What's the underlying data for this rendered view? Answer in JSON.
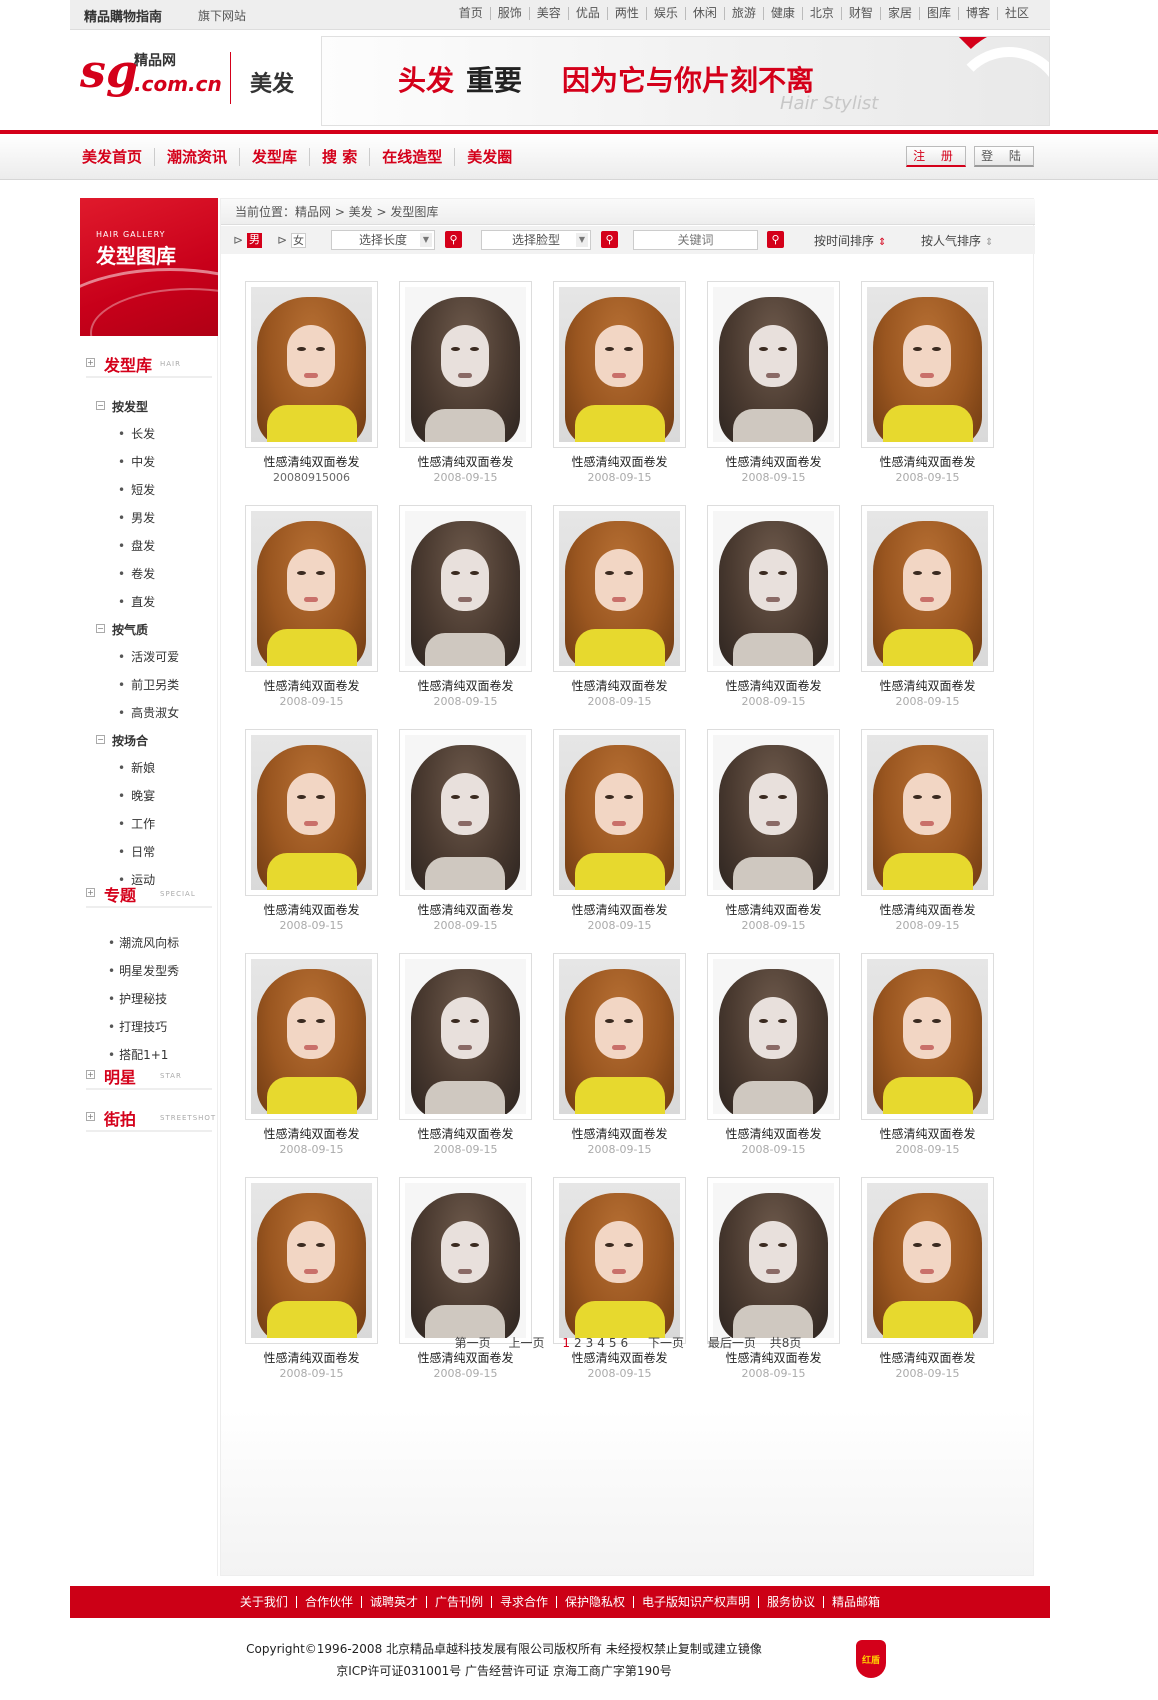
{
  "topbar": {
    "brand": "精品購物指南",
    "sub": "旗下网站",
    "links": [
      "首页",
      "服饰",
      "美容",
      "优品",
      "两性",
      "娱乐",
      "休闲",
      "旅游",
      "健康",
      "北京",
      "财智",
      "家居",
      "图库",
      "博客",
      "社区"
    ]
  },
  "header": {
    "logo_sg": "sg",
    "logo_name": "精品网",
    "logo_domain": ".com.cn",
    "section": "美发",
    "banner": {
      "slogan_part1": "头发",
      "slogan_part2": "重要",
      "slogan_part3": "因为它与你片刻不离",
      "subtitle": "Hair Stylist"
    }
  },
  "nav": {
    "items": [
      "美发首页",
      "潮流资讯",
      "发型库",
      "搜 索",
      "在线造型",
      "美发圈"
    ],
    "register": "注 册",
    "login": "登 陆"
  },
  "sidebar": {
    "head_en": "HAIR GALLERY",
    "head_cn": "发型图库",
    "sections": [
      {
        "title": "发型库",
        "en": "HAIR"
      },
      {
        "title": "专题",
        "en": "SPECIAL"
      },
      {
        "title": "明星",
        "en": "STAR"
      },
      {
        "title": "街拍",
        "en": "STREETSHOT"
      }
    ],
    "groups": [
      {
        "title": "按发型",
        "items": [
          "长发",
          "中发",
          "短发",
          "男发",
          "盘发",
          "卷发",
          "直发"
        ]
      },
      {
        "title": "按气质",
        "items": [
          "活泼可爱",
          "前卫另类",
          "高贵淑女"
        ]
      },
      {
        "title": "按场合",
        "items": [
          "新娘",
          "晚宴",
          "工作",
          "日常",
          "运动"
        ]
      }
    ],
    "special_items": [
      "潮流风向标",
      "明星发型秀",
      "护理秘技",
      "打理技巧",
      "搭配1+1"
    ]
  },
  "main": {
    "breadcrumb": "当前位置：精品网 > 美发 > 发型图库",
    "filter": {
      "male": "男",
      "female": "女",
      "length_select": "选择长度",
      "face_select": "选择脸型",
      "keyword_placeholder": "关键词",
      "sort_time": "按时间排序",
      "sort_popular": "按人气排序"
    },
    "cards": [
      {
        "title": "性感清纯双面卷发",
        "date": "20080915006",
        "style": "a"
      },
      {
        "title": "性感清纯双面卷发",
        "date": "2008-09-15",
        "style": "b"
      },
      {
        "title": "性感清纯双面卷发",
        "date": "2008-09-15",
        "style": "a"
      },
      {
        "title": "性感清纯双面卷发",
        "date": "2008-09-15",
        "style": "b"
      },
      {
        "title": "性感清纯双面卷发",
        "date": "2008-09-15",
        "style": "a"
      },
      {
        "title": "性感清纯双面卷发",
        "date": "2008-09-15",
        "style": "a"
      },
      {
        "title": "性感清纯双面卷发",
        "date": "2008-09-15",
        "style": "b"
      },
      {
        "title": "性感清纯双面卷发",
        "date": "2008-09-15",
        "style": "a"
      },
      {
        "title": "性感清纯双面卷发",
        "date": "2008-09-15",
        "style": "b"
      },
      {
        "title": "性感清纯双面卷发",
        "date": "2008-09-15",
        "style": "a"
      },
      {
        "title": "性感清纯双面卷发",
        "date": "2008-09-15",
        "style": "a"
      },
      {
        "title": "性感清纯双面卷发",
        "date": "2008-09-15",
        "style": "b"
      },
      {
        "title": "性感清纯双面卷发",
        "date": "2008-09-15",
        "style": "a"
      },
      {
        "title": "性感清纯双面卷发",
        "date": "2008-09-15",
        "style": "b"
      },
      {
        "title": "性感清纯双面卷发",
        "date": "2008-09-15",
        "style": "a"
      },
      {
        "title": "性感清纯双面卷发",
        "date": "2008-09-15",
        "style": "a"
      },
      {
        "title": "性感清纯双面卷发",
        "date": "2008-09-15",
        "style": "b"
      },
      {
        "title": "性感清纯双面卷发",
        "date": "2008-09-15",
        "style": "a"
      },
      {
        "title": "性感清纯双面卷发",
        "date": "2008-09-15",
        "style": "b"
      },
      {
        "title": "性感清纯双面卷发",
        "date": "2008-09-15",
        "style": "a"
      },
      {
        "title": "性感清纯双面卷发",
        "date": "2008-09-15",
        "style": "a"
      },
      {
        "title": "性感清纯双面卷发",
        "date": "2008-09-15",
        "style": "b"
      },
      {
        "title": "性感清纯双面卷发",
        "date": "2008-09-15",
        "style": "a"
      },
      {
        "title": "性感清纯双面卷发",
        "date": "2008-09-15",
        "style": "b"
      },
      {
        "title": "性感清纯双面卷发",
        "date": "2008-09-15",
        "style": "a"
      }
    ],
    "pager": {
      "first": "第一页",
      "prev": "上一页",
      "pages": [
        "1",
        "2",
        "3",
        "4",
        "5",
        "6"
      ],
      "current": "1",
      "next": "下一页",
      "last": "最后一页",
      "total": "共8页"
    }
  },
  "footer": {
    "links": [
      "关于我们",
      "合作伙伴",
      "诚聘英才",
      "广告刊例",
      "寻求合作",
      "保护隐私权",
      "电子版知识产权声明",
      "服务协议",
      "精品邮箱"
    ],
    "copyright": "Copyright©1996-2008 北京精品卓越科技发展有限公司版权所有  未经授权禁止复制或建立镜像",
    "license": "京ICP许可证031001号  广告经营许可证 京海工商广字第190号",
    "badge": "红盾"
  },
  "colors": {
    "brand_red": "#d4001a",
    "footer_red": "#cc0016"
  }
}
